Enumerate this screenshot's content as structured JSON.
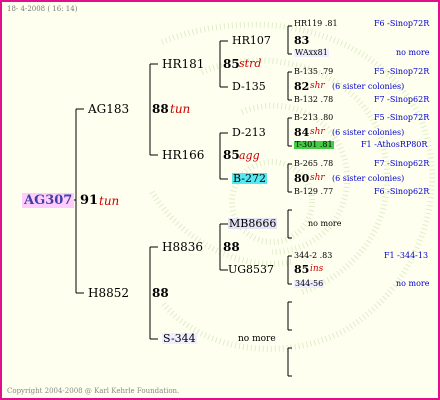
{
  "header": {
    "date": "18-  4-2008 ( 16: 14)"
  },
  "footer": {
    "copyright": "Copyright 2004-2008 @ Karl Kehrle Foundation."
  },
  "colors": {
    "border": "#e0108c",
    "red": "#cc0000",
    "blue": "#0000cc",
    "root_bg": "#ffccff",
    "cyan_bg": "#55e8f0",
    "green_bg": "#44cc44"
  },
  "root": {
    "name": "AG307",
    "num": "91",
    "note": "tun"
  },
  "gen1": {
    "upper": {
      "name": "AG183",
      "num": "88",
      "note": "tun"
    },
    "lower": {
      "name": "H8852",
      "num": "88"
    }
  },
  "gen2": {
    "hr181": {
      "name": "HR181",
      "num": "85",
      "note": "strd"
    },
    "hr166": {
      "name": "HR166",
      "num": "85",
      "note": "agg"
    },
    "h8836": {
      "name": "H8836",
      "num": "88"
    },
    "s344": {
      "name": "S-344",
      "note": "no more"
    }
  },
  "gen3": {
    "hr107": {
      "name": "HR107",
      "num": "83"
    },
    "d135": {
      "name": "D-135",
      "num": "82",
      "note": "shr",
      "extra": "(6 sister colonies)"
    },
    "d213": {
      "name": "D-213",
      "num": "84",
      "note": "shr",
      "extra": "(6 sister colonies)"
    },
    "b272": {
      "name": "B-272",
      "num": "80",
      "note": "shr",
      "extra": "(6 sister colonies)"
    },
    "mb8666": {
      "name": "MB8666",
      "note": "no more"
    },
    "ug8537": {
      "name": "UG8537",
      "num": "85",
      "note": "ins"
    }
  },
  "gen4": [
    {
      "name": "HR119 .81",
      "info": "F6 -Sinop72R"
    },
    {
      "name": "WAxx81",
      "info": "no more"
    },
    {
      "name": "B-135 .79",
      "info": "F5 -Sinop72R"
    },
    {
      "name": "B-132 .78",
      "info": "F7 -Sinop62R"
    },
    {
      "name": "B-213 .80",
      "info": "F5 -Sinop72R"
    },
    {
      "name": "T-301 .81",
      "info": "F1 -AthosRP80R"
    },
    {
      "name": "B-265 .78",
      "info": "F7 -Sinop62R"
    },
    {
      "name": "B-129 .77",
      "info": "F6 -Sinop62R"
    },
    {
      "name": "344-2 .83",
      "info": "F1 -344-13"
    },
    {
      "name": "344-56",
      "info": "no more"
    }
  ]
}
